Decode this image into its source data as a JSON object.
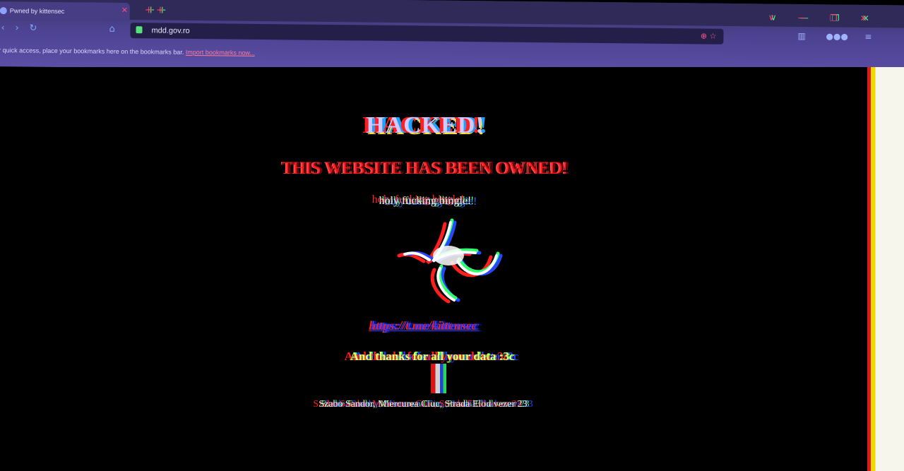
{
  "browser": {
    "tab_title": "Pwned by kittensec",
    "url": "mdd.gov.ro",
    "bookmarks_hint": "or quick access, place your bookmarks here on the bookmarks bar.",
    "bookmarks_link": "Import bookmarks now..."
  },
  "page": {
    "heading": "HACKED!",
    "subheading": "THIS WEBSITE HAS BEEN OWNED!",
    "tagline": "holy fucking bingle!",
    "link": "https://t.me/kittensec",
    "thanks": "And thanks for all your data :3c",
    "address": "Szabo Sandor, Miercurea Ciuc, Strada Elod vezer 23"
  },
  "colors": {
    "chrome": "#4c4290",
    "heading_red": "#ff1a1a",
    "link_blue": "#2f3cff",
    "thanks_yellow": "#e9ff6a",
    "background": "#000000"
  },
  "icons": [
    "back-icon",
    "forward-icon",
    "reload-icon",
    "home-icon",
    "lock-icon",
    "extension-icon",
    "menu-icon",
    "window-minimize-icon",
    "window-maximize-icon",
    "window-close-icon"
  ]
}
